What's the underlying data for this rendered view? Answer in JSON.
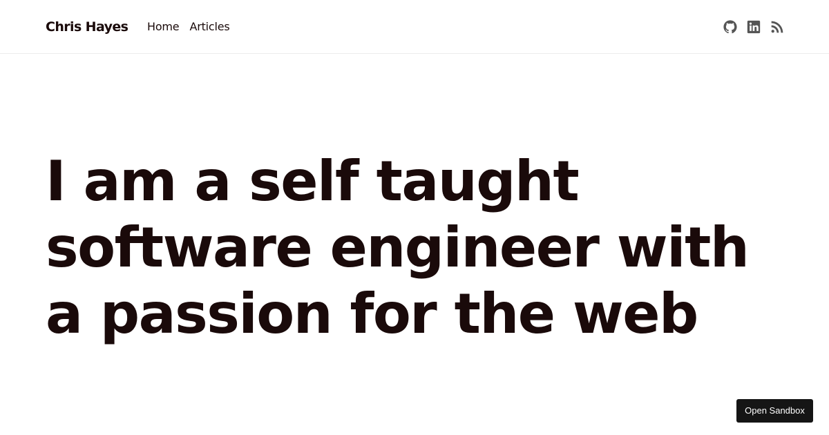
{
  "site": {
    "brand": "Chris Hayes"
  },
  "nav": {
    "items": [
      {
        "label": "Home"
      },
      {
        "label": "Articles"
      }
    ]
  },
  "social": {
    "icons": [
      "github-icon",
      "linkedin-icon",
      "rss-icon"
    ],
    "icon_color": "#555555"
  },
  "hero": {
    "lines": [
      "I am a self taught",
      "software engineer with",
      "a passion for the web"
    ],
    "text_color": "#1a0a0a"
  },
  "sandbox": {
    "label": "Open Sandbox",
    "background": "#151515"
  }
}
